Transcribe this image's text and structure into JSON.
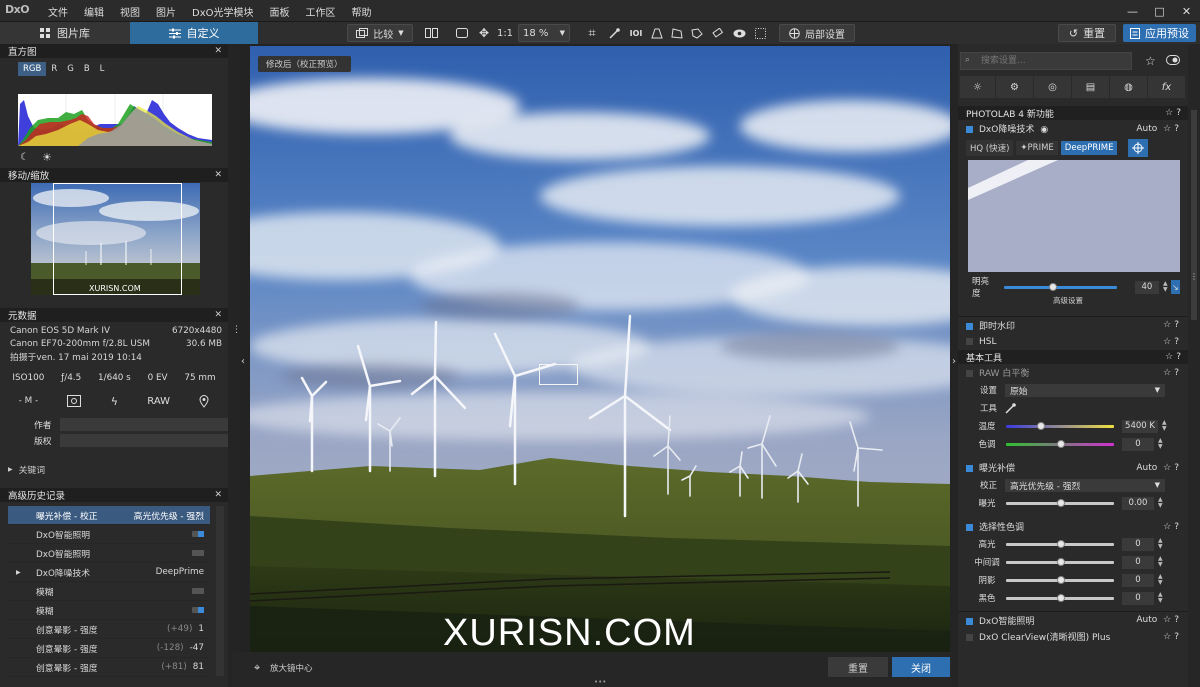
{
  "app": {
    "logo": "DxO",
    "menus": [
      "文件",
      "编辑",
      "视图",
      "图片",
      "DxO光学模块",
      "面板",
      "工作区",
      "帮助"
    ]
  },
  "window_controls": {
    "minimize": "—",
    "maximize": "□",
    "close": "✕"
  },
  "toolbar": {
    "tab_library": "图片库",
    "tab_custom": "自定义",
    "compare": "比较",
    "ratio": "1:1",
    "zoom": "18 %",
    "local_settings": "局部设置",
    "reset": "重置",
    "apply_preset": "应用预设"
  },
  "left": {
    "histogram": {
      "title": "直方图",
      "channels": [
        "RGB",
        "R",
        "G",
        "B",
        "L"
      ],
      "active_channel": "RGB"
    },
    "navigator": {
      "title": "移动/缩放",
      "watermark": "XURISN.COM"
    },
    "metadata": {
      "title": "元数据",
      "rows": [
        {
          "left": "Canon EOS 5D Mark IV",
          "right": "6720x4480"
        },
        {
          "left": "Canon EF70-200mm f/2.8L USM",
          "right": "30.6 MB"
        },
        {
          "left": "拍摄于ven. 17 mai 2019 10:14",
          "right": ""
        }
      ],
      "exif": [
        "ISO100",
        "ƒ/4.5",
        "1/640 s",
        "0 EV",
        "75 mm"
      ],
      "exif2": [
        "- M -",
        "RAW"
      ],
      "author_label": "作者",
      "copyright_label": "版权",
      "keywords": "关键词"
    },
    "history": {
      "title": "高级历史记录",
      "items": [
        {
          "name": "曝光补偿 - 校正",
          "detail": "高光优先级 - 强烈",
          "prev": "",
          "selected": true,
          "toggle": ""
        },
        {
          "name": "DxO智能照明",
          "detail": "",
          "prev": "",
          "selected": false,
          "toggle": "on"
        },
        {
          "name": "DxO智能照明",
          "detail": "",
          "prev": "",
          "selected": false,
          "toggle": "off"
        },
        {
          "name": "DxO降噪技术",
          "detail": "DeepPrime",
          "prev": "",
          "selected": false,
          "toggle": ""
        },
        {
          "name": "模糊",
          "detail": "",
          "prev": "",
          "selected": false,
          "toggle": "off"
        },
        {
          "name": "模糊",
          "detail": "",
          "prev": "",
          "selected": false,
          "toggle": "on"
        },
        {
          "name": "创意晕影 - 强度",
          "detail": "1",
          "prev": "(+49)",
          "selected": false,
          "toggle": ""
        },
        {
          "name": "创意晕影 - 强度",
          "detail": "-47",
          "prev": "(-128)",
          "selected": false,
          "toggle": ""
        },
        {
          "name": "创意晕影 - 强度",
          "detail": "81",
          "prev": "(+81)",
          "selected": false,
          "toggle": ""
        }
      ]
    }
  },
  "viewer": {
    "badge": "修改后（校正预览）",
    "watermark": "XURISN.COM",
    "loupe_center": "放大镜中心",
    "reset": "重置",
    "close": "关闭"
  },
  "right": {
    "search_placeholder": "搜索设置...",
    "new_features": "PHOTOLAB 4 新功能",
    "denoise": {
      "title": "DxO降噪技术",
      "auto": "Auto",
      "modes": [
        "HQ (快速)",
        "✦PRIME",
        "DeepPRIME"
      ],
      "active_mode": "DeepPRIME",
      "brightness_label": "明亮度",
      "brightness": "40",
      "brightness_level": 0.4,
      "advanced": "高级设置"
    },
    "watermark_title": "即时水印",
    "hsl_title": "HSL",
    "basic_tools": "基本工具",
    "wb": {
      "title": "RAW 白平衡",
      "settings_label": "设置",
      "settings_value": "原始",
      "tool_label": "工具",
      "temp_label": "温度",
      "temp_value": "5400 K",
      "tint_label": "色调",
      "tint_value": "0"
    },
    "exposure": {
      "title": "曝光补偿",
      "auto": "Auto",
      "correction_label": "校正",
      "correction_value": "高光优先级 - 强烈",
      "exposure_label": "曝光",
      "exposure_value": "0.00"
    },
    "selective": {
      "title": "选择性色调",
      "rows": [
        {
          "label": "高光",
          "value": "0"
        },
        {
          "label": "中间调",
          "value": "0"
        },
        {
          "label": "阴影",
          "value": "0"
        },
        {
          "label": "黑色",
          "value": "0"
        }
      ]
    },
    "smartlight": {
      "title": "DxO智能照明",
      "auto": "Auto"
    },
    "clearview": {
      "title": "DxO ClearView(清晰视图) Plus"
    }
  }
}
